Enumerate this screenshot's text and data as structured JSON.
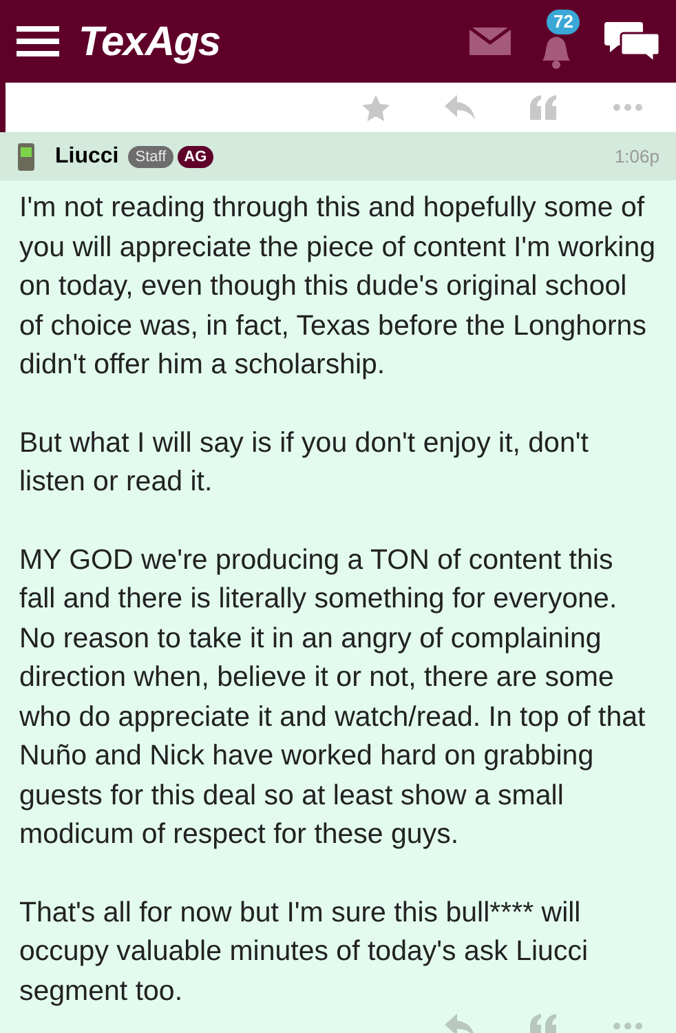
{
  "header": {
    "logo": "TexAgs",
    "notification_count": "72"
  },
  "post": {
    "author": "Liucci",
    "badges": [
      {
        "label": "Staff",
        "kind": "staff"
      },
      {
        "label": "AG",
        "kind": "ag"
      }
    ],
    "time": "1:06p",
    "paragraphs": [
      "I'm not reading through this and hopefully some of you will appreciate the piece of content I'm working on today, even though this dude's original school of choice was, in fact, Texas before the Longhorns didn't offer him a scholarship.",
      "But what I will say is if you don't enjoy it, don't listen or read it.",
      "MY GOD we're producing a TON of content this fall and there is literally something for everyone. No reason to take it in an angry of complaining direction when, believe it or not, there are some who do appreciate it and watch/read. In top of that Nuño and Nick have worked hard on grabbing guests for this deal so at least show a small modicum of respect for these guys.",
      "That's all for now but I'm sure this bull**** will occupy valuable minutes of today's ask Liucci segment too."
    ]
  }
}
